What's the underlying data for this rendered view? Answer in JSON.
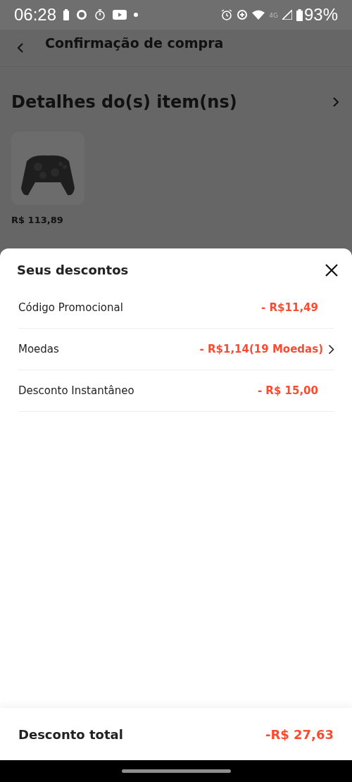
{
  "status_bar": {
    "time": "06:28",
    "network": "4G",
    "battery": "93%"
  },
  "page": {
    "title": "Confirmação de compra",
    "section_title": "Detalhes do(s) item(ns)",
    "item": {
      "price": "R$ 113,89"
    }
  },
  "sheet": {
    "title": "Seus descontos",
    "discounts": [
      {
        "label": "Código Promocional",
        "amount": "- R$11,49",
        "has_arrow": false
      },
      {
        "label": "Moedas",
        "amount": "- R$1,14(19 Moedas)",
        "has_arrow": true
      },
      {
        "label": "Desconto Instantâneo",
        "amount": "- R$ 15,00",
        "has_arrow": false
      }
    ],
    "total": {
      "label": "Desconto total",
      "amount": "-R$ 27,63"
    }
  }
}
